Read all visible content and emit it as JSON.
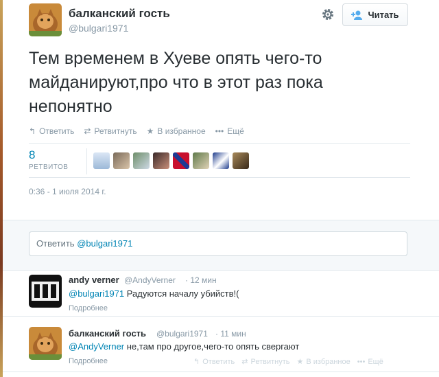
{
  "tweet": {
    "author_name": "балканский гость",
    "author_handle": "@bulgari1971",
    "follow_label": "Читать",
    "text": "Тем временем в Хуеве опять чего-то майданируют,про что в этот раз пока непонятно",
    "actions": {
      "reply": "Ответить",
      "retweet": "Ретвитнуть",
      "favorite": "В избранное",
      "more": "Ещё"
    },
    "retweet_count": "8",
    "retweet_label": "РЕТВИТОВ",
    "timestamp": "0:36 - 1 июля 2014 г."
  },
  "reply_box": {
    "prefix": "Ответить",
    "mention": "@bulgari1971"
  },
  "replies": [
    {
      "name": "andy verner",
      "handle": "@AndyVerner",
      "time": "· 12 мин",
      "mention": "@bulgari1971",
      "text": " Радуются началу убийств!(",
      "more": "Подробнее"
    },
    {
      "name": "балканский гость",
      "handle": "@bulgari1971",
      "time": "· 11 мин",
      "mention": "@AndyVerner",
      "text": " не,там про другое,чего-то опять свергают",
      "more": "Подробнее",
      "actions": {
        "reply": "Ответить",
        "retweet": "Ретвитнуть",
        "favorite": "В избранное",
        "more": "Ещё"
      }
    }
  ],
  "colors": {
    "link": "#0084b4",
    "muted": "#8899a6",
    "text": "#292f33"
  }
}
